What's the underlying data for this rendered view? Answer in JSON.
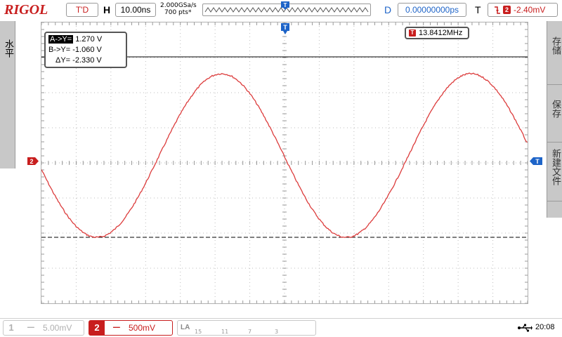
{
  "top": {
    "brand": "RIGOL",
    "run_state": "T'D",
    "h_label": "H",
    "timebase": "10.00ns",
    "sample_rate": "2.000GSa/s",
    "memory_depth": "700 pts*",
    "d_label": "D",
    "delay": "0.00000000ps",
    "t_label": "T",
    "trigger_source": "2",
    "trigger_level": "-2.40mV"
  },
  "left_menu": {
    "label": "水平"
  },
  "right_menu": {
    "items": [
      "存储",
      "保存",
      "新建文件"
    ]
  },
  "cursor": {
    "a_label": "A->Y=",
    "a_value": "1.270 V",
    "b_label": "B->Y=",
    "b_value": "-1.060 V",
    "delta_label": "ΔY=",
    "delta_value": "-2.330 V"
  },
  "measurement": {
    "channel": "T",
    "frequency": "13.8412MHz"
  },
  "markers": {
    "channel2": "2",
    "trigger": "T"
  },
  "bottom": {
    "ch1": {
      "number": "1",
      "coupling": "━━",
      "scale": "5.00mV"
    },
    "ch2": {
      "number": "2",
      "coupling": "━━",
      "scale": "500mV"
    },
    "la": {
      "label": "LA",
      "groups": [
        "15",
        "11",
        "7",
        "3"
      ]
    },
    "time": "20:08"
  },
  "colors": {
    "ch2_trace": "#dc3c3c",
    "accent_red": "#c81e1e",
    "accent_blue": "#1e64c8",
    "panel_gray": "#c8c8c8"
  },
  "waveform": {
    "channel": "2",
    "shape": "sine",
    "cycles_visible": 1.95,
    "high_level_v": 1.27,
    "low_level_v": -1.06,
    "volts_per_div": 0.5
  }
}
